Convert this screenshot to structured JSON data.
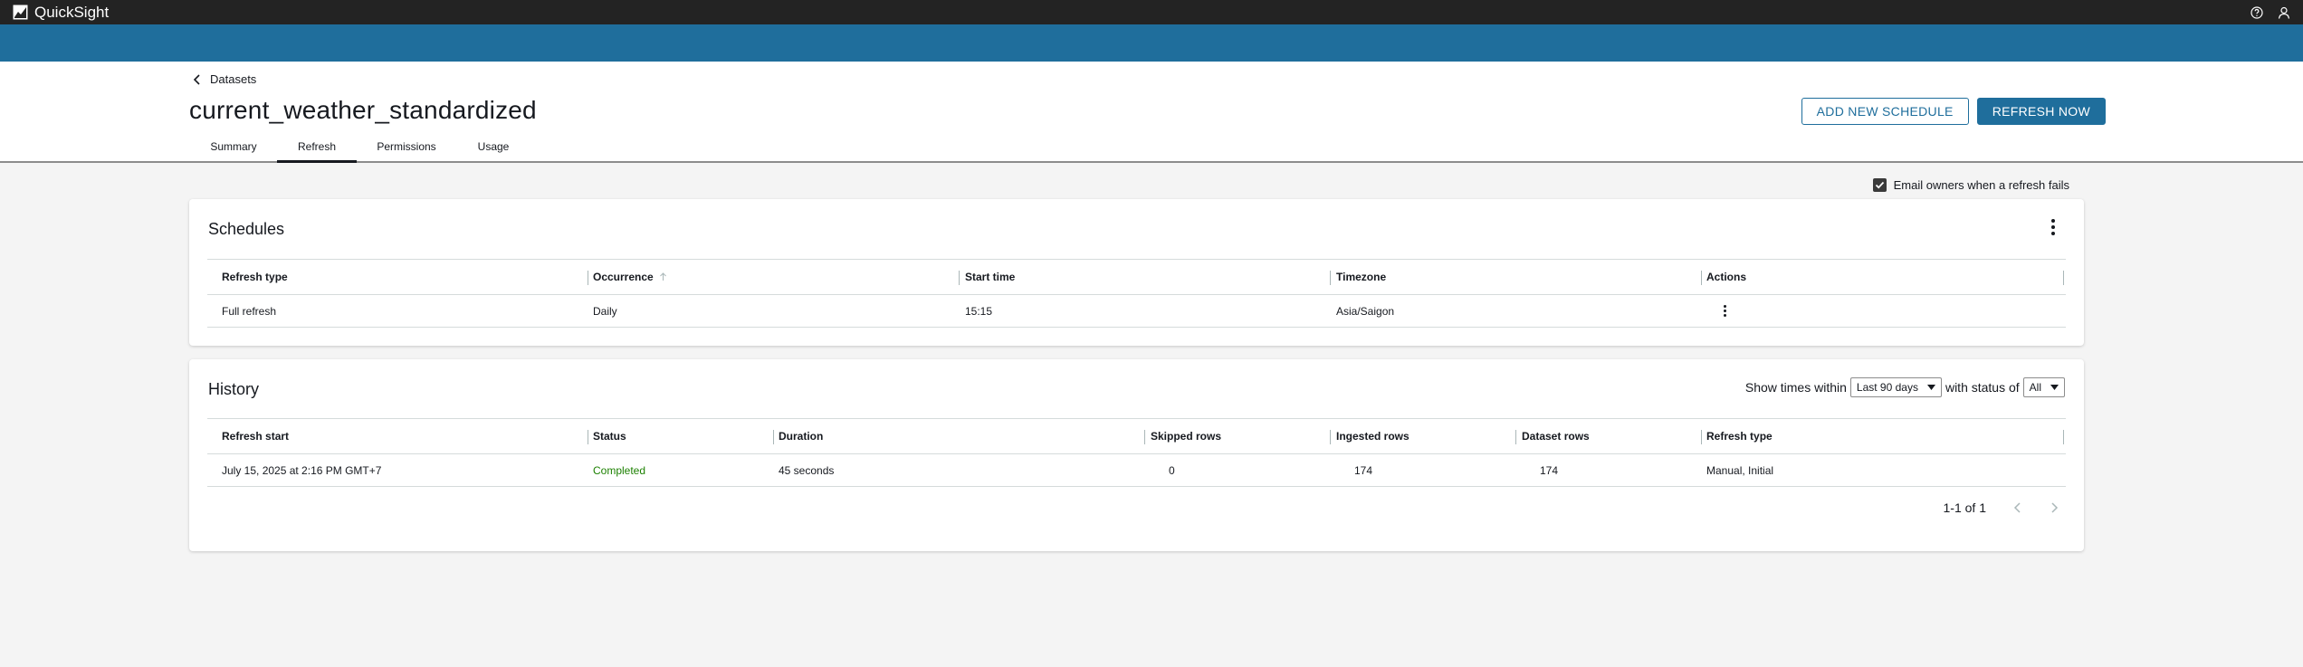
{
  "app": {
    "brand": "QuickSight",
    "brand_icon": "quicksight-logo-icon",
    "help_icon": "help-icon",
    "user_icon": "user-icon"
  },
  "colors": {
    "topbar": "#232323",
    "accent": "#1f6e9c",
    "success": "#1d8102"
  },
  "breadcrumb": {
    "label": "Datasets",
    "icon": "chevron-left-icon"
  },
  "page": {
    "title": "current_weather_standardized"
  },
  "actions": {
    "add_schedule": "ADD NEW SCHEDULE",
    "refresh_now": "REFRESH NOW"
  },
  "tabs": [
    {
      "label": "Summary",
      "active": false
    },
    {
      "label": "Refresh",
      "active": true
    },
    {
      "label": "Permissions",
      "active": false
    },
    {
      "label": "Usage",
      "active": false
    }
  ],
  "email_option": {
    "label": "Email owners when a refresh fails",
    "checked": true
  },
  "schedules": {
    "title": "Schedules",
    "columns": [
      "Refresh type",
      "Occurrence",
      "Start time",
      "Timezone",
      "Actions"
    ],
    "sorted_column": "Occurrence",
    "rows": [
      {
        "refresh_type": "Full refresh",
        "occurrence": "Daily",
        "start_time": "15:15",
        "timezone": "Asia/Saigon"
      }
    ]
  },
  "history": {
    "title": "History",
    "filter_prefix": "Show times within",
    "time_range": "Last 90 days",
    "filter_mid": "with status of",
    "status_filter": "All",
    "columns": [
      "Refresh start",
      "Status",
      "Duration",
      "Skipped rows",
      "Ingested rows",
      "Dataset rows",
      "Refresh type"
    ],
    "rows": [
      {
        "refresh_start": "July 15, 2025 at 2:16 PM GMT+7",
        "status": "Completed",
        "duration": "45 seconds",
        "skipped_rows": "0",
        "ingested_rows": "174",
        "dataset_rows": "174",
        "refresh_type": "Manual, Initial"
      }
    ],
    "pagination": "1-1 of 1"
  }
}
